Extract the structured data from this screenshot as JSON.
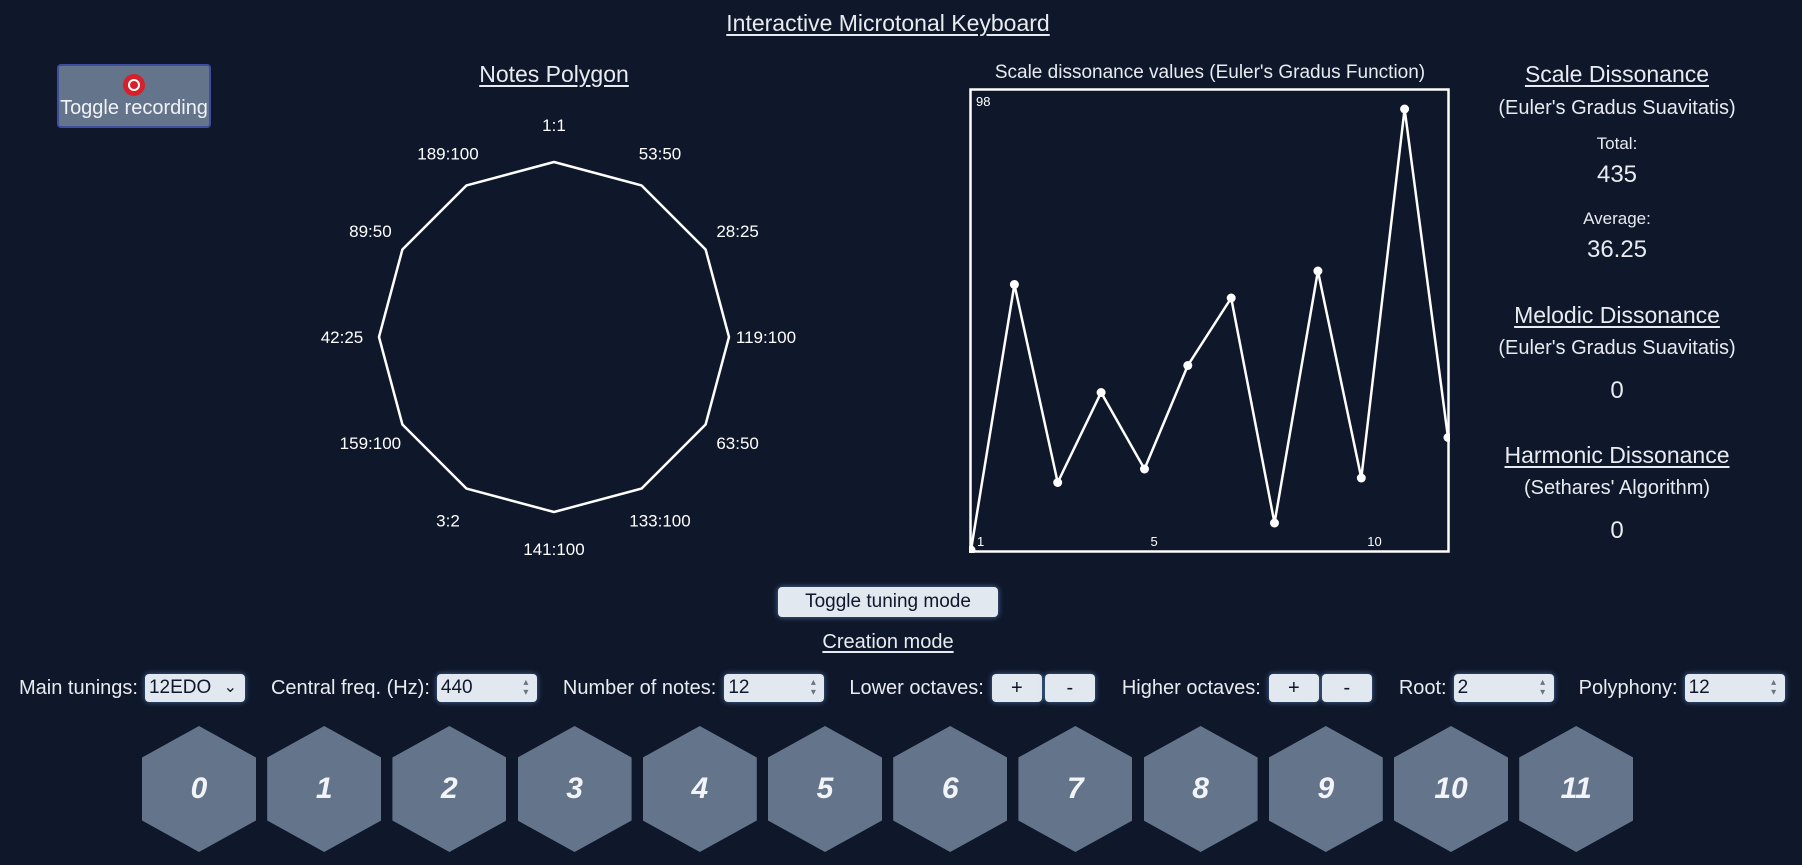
{
  "app": {
    "title": "Interactive Microtonal Keyboard"
  },
  "recording": {
    "label": "Toggle recording",
    "icon": "record-icon"
  },
  "polygon": {
    "heading": "Notes Polygon",
    "labels": [
      "1:1",
      "53:50",
      "28:25",
      "119:100",
      "63:50",
      "133:100",
      "141:100",
      "3:2",
      "159:100",
      "42:25",
      "89:50",
      "189:100"
    ]
  },
  "chart": {
    "title": "Scale dissonance values (Euler's Gradus Function)",
    "top_label": "98",
    "x_tick_labels": [
      "1",
      "5",
      "10"
    ]
  },
  "chart_data": {
    "type": "line",
    "title": "Scale dissonance values (Euler's Gradus Function)",
    "x": [
      1,
      2,
      3,
      4,
      5,
      6,
      7,
      8,
      9,
      10,
      11,
      12
    ],
    "y": [
      0,
      59,
      15,
      35,
      18,
      41,
      56,
      6,
      62,
      16,
      98,
      25
    ],
    "ylim": [
      0,
      100
    ],
    "grid": false,
    "color": "#ffffff"
  },
  "scale_dissonance": {
    "heading": "Scale Dissonance",
    "subheading": "(Euler's Gradus Suavitatis)",
    "total_label": "Total:",
    "total_value": "435",
    "average_label": "Average:",
    "average_value": "36.25"
  },
  "melodic_dissonance": {
    "heading": "Melodic Dissonance",
    "subheading": "(Euler's Gradus Suavitatis)",
    "value": "0"
  },
  "harmonic_dissonance": {
    "heading": "Harmonic Dissonance",
    "subheading": "(Sethares' Algorithm)",
    "value": "0"
  },
  "tuning": {
    "toggle_label": "Toggle tuning mode",
    "mode_label": "Creation mode"
  },
  "controls": {
    "main_tunings_label": "Main tunings:",
    "main_tunings_value": "12EDO",
    "central_freq_label": "Central freq. (Hz):",
    "central_freq_value": "440",
    "num_notes_label": "Number of notes:",
    "num_notes_value": "12",
    "lower_octaves_label": "Lower octaves:",
    "higher_octaves_label": "Higher octaves:",
    "plus": "+",
    "minus": "-",
    "root_label": "Root:",
    "root_value": "2",
    "polyphony_label": "Polyphony:",
    "polyphony_value": "12"
  },
  "keys": [
    "0",
    "1",
    "2",
    "3",
    "4",
    "5",
    "6",
    "7",
    "8",
    "9",
    "10",
    "11"
  ],
  "colors": {
    "background": "#0f172a",
    "key": "#64748b",
    "record": "#d6202c",
    "control": "#e2e8f0"
  }
}
